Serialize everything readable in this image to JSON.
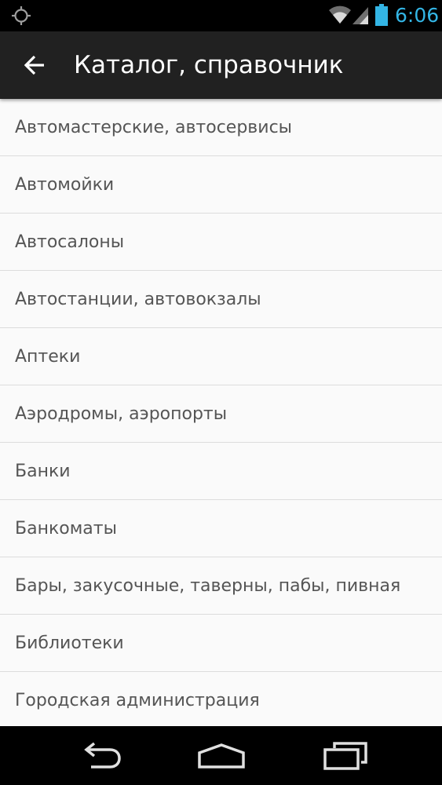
{
  "status_bar": {
    "time": "6:06",
    "icons": [
      "gps-icon",
      "wifi-icon",
      "signal-icon",
      "battery-icon"
    ]
  },
  "action_bar": {
    "title": "Каталог, справочник",
    "back_icon": "arrow-left-icon"
  },
  "catalog": {
    "items": [
      {
        "label": "Автомастерские, автосервисы"
      },
      {
        "label": "Автомойки"
      },
      {
        "label": "Автосалоны"
      },
      {
        "label": "Автостанции, автовокзалы"
      },
      {
        "label": "Аптеки"
      },
      {
        "label": "Аэродромы, аэропорты"
      },
      {
        "label": "Банки"
      },
      {
        "label": "Банкоматы"
      },
      {
        "label": "Бары, закусочные, таверны, пабы, пивная"
      },
      {
        "label": "Библиотеки"
      },
      {
        "label": "Городская администрация"
      }
    ]
  },
  "nav_bar": {
    "icons": [
      "nav-back-icon",
      "nav-home-icon",
      "nav-recents-icon"
    ]
  },
  "colors": {
    "status_time": "#33b5e5",
    "action_bar_bg": "#212121",
    "list_bg": "#fafafa",
    "list_text": "#555555",
    "divider": "#dcdcdc"
  }
}
